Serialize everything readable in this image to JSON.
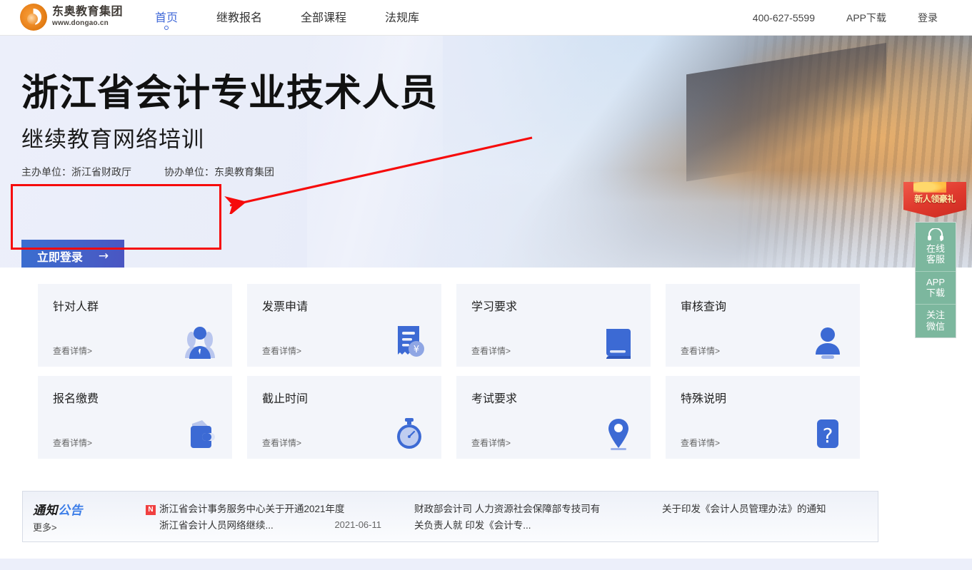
{
  "header": {
    "logo": {
      "name_cn": "东奥教育集团",
      "url": "www.dongao.cn",
      "icon": "dongao-logo-icon"
    },
    "nav": [
      {
        "label": "首页",
        "active": true
      },
      {
        "label": "继教报名",
        "active": false
      },
      {
        "label": "全部课程",
        "active": false
      },
      {
        "label": "法规库",
        "active": false
      }
    ],
    "right": [
      {
        "label": "400-627-5599",
        "name": "hotline"
      },
      {
        "label": "APP下载",
        "name": "app-download"
      },
      {
        "label": "登录",
        "name": "login"
      }
    ]
  },
  "hero": {
    "title": "浙江省会计专业技术人员",
    "subtitle": "继续教育网络培训",
    "host_label": "主办单位：浙江省财政厅",
    "coorg_label": "协办单位：东奥教育集团",
    "login_button": "立即登录",
    "login_arrow": "→"
  },
  "side_widget": {
    "ribbon": "新人领豪礼",
    "items": [
      {
        "line1": "在线",
        "line2": "客服",
        "icon": "headset-icon"
      },
      {
        "line1": "APP",
        "line2": "下载",
        "icon": "app-icon"
      },
      {
        "line1": "关注",
        "line2": "微信",
        "icon": "wechat-icon"
      }
    ],
    "color": "#7cb79e"
  },
  "cards": {
    "more_label": "查看详情>",
    "items": [
      {
        "title": "针对人群",
        "icon": "people-icon"
      },
      {
        "title": "发票申请",
        "icon": "invoice-icon"
      },
      {
        "title": "学习要求",
        "icon": "book-icon"
      },
      {
        "title": "审核查询",
        "icon": "stamp-person-icon"
      },
      {
        "title": "报名缴费",
        "icon": "wallet-icon"
      },
      {
        "title": "截止时间",
        "icon": "stopwatch-icon"
      },
      {
        "title": "考试要求",
        "icon": "location-pin-icon"
      },
      {
        "title": "特殊说明",
        "icon": "question-mark-icon"
      }
    ]
  },
  "notice": {
    "label_part1": "通知",
    "label_part2": "公告",
    "more": "更多>",
    "badge": "N",
    "columns": [
      {
        "line1": "浙江省会计事务服务中心关于开通2021年度",
        "line2": "浙江省会计人员网络继续...",
        "date": "2021-06-11",
        "has_badge": true
      },
      {
        "line1": "财政部会计司 人力资源社会保障部专技司有",
        "line2": "关负责人就 印发《会计专...",
        "date": "",
        "has_badge": false
      },
      {
        "line1": "关于印发《会计人员管理办法》的通知",
        "line2": "",
        "date": "",
        "has_badge": false
      }
    ]
  },
  "annotation": {
    "highlight_color": "#f60b0b",
    "target": "立即登录"
  },
  "colors": {
    "brand_blue": "#4169d8",
    "accent_orange": "#ef8b25",
    "card_bg": "#f3f5fa",
    "page_bg": "#eceffa"
  }
}
